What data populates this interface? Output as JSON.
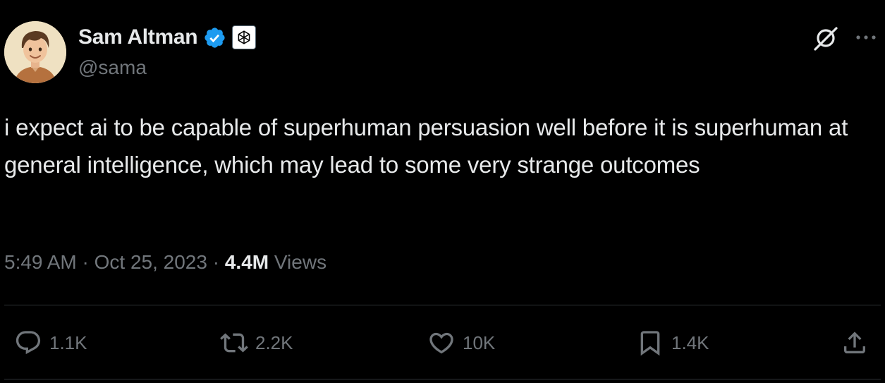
{
  "author": {
    "display_name": "Sam Altman",
    "handle": "@sama",
    "verified": true,
    "verified_color": "#1d9bf0"
  },
  "tweet": {
    "text": "i expect ai to be capable of superhuman persuasion well before it is superhuman at general intelligence, which may lead to some very strange outcomes"
  },
  "meta": {
    "time": "5:49 AM",
    "separator": "·",
    "date": "Oct 25, 2023",
    "views_count": "4.4M",
    "views_label": "Views"
  },
  "actions": {
    "replies": "1.1K",
    "reposts": "2.2K",
    "likes": "10K",
    "bookmarks": "1.4K"
  },
  "icons": {
    "verified": "verified-badge-icon",
    "affiliate": "openai-logo-icon",
    "grok": "grok-icon",
    "more": "more-icon",
    "reply": "reply-icon",
    "repost": "repost-icon",
    "like": "heart-icon",
    "bookmark": "bookmark-icon",
    "share": "share-icon"
  },
  "colors": {
    "background": "#000000",
    "primary_text": "#e7e9ea",
    "secondary_text": "#71767b",
    "divider": "#2f3336",
    "accent": "#1d9bf0"
  }
}
